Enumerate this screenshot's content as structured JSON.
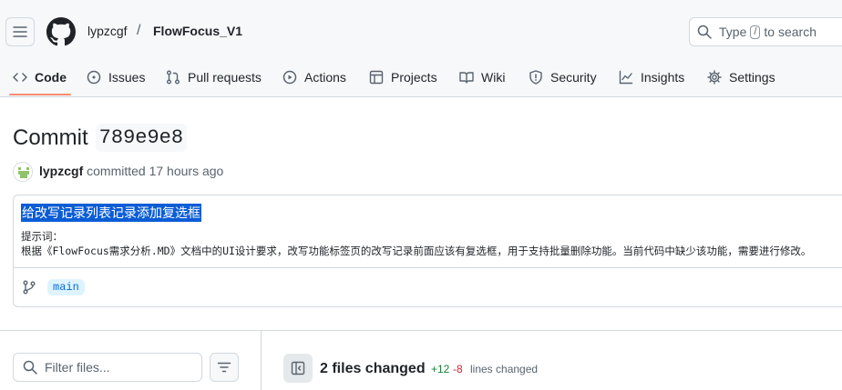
{
  "header": {
    "owner": "lypzcgf",
    "separator": "/",
    "repo": "FlowFocus_V1",
    "search": {
      "prefix": "Type",
      "key": "/",
      "suffix": "to search"
    }
  },
  "tabs": [
    {
      "label": "Code",
      "icon": "code-icon",
      "active": true
    },
    {
      "label": "Issues",
      "icon": "issue-icon"
    },
    {
      "label": "Pull requests",
      "icon": "pull-request-icon"
    },
    {
      "label": "Actions",
      "icon": "play-icon"
    },
    {
      "label": "Projects",
      "icon": "table-icon"
    },
    {
      "label": "Wiki",
      "icon": "book-icon"
    },
    {
      "label": "Security",
      "icon": "shield-icon"
    },
    {
      "label": "Insights",
      "icon": "graph-icon"
    },
    {
      "label": "Settings",
      "icon": "gear-icon"
    }
  ],
  "commit": {
    "heading": "Commit",
    "sha": "789e9e8",
    "author": "lypzcgf",
    "committed_text": "committed 17 hours ago",
    "title": "给改写记录列表记录添加复选框",
    "body_line1": "提示词：",
    "body_line2": "根据《FlowFocus需求分析.MD》文档中的UI设计要求，改写功能标签页的改写记录前面应该有复选框，用于支持批量删除功能。当前代码中缺少该功能，需要进行修改。",
    "branch": "main"
  },
  "files": {
    "filter_placeholder": "Filter files...",
    "files_changed": "2 files changed",
    "additions": "+12",
    "deletions": "-8",
    "lines_changed": "lines changed"
  },
  "colors": {
    "accent_underline": "#fd8c73",
    "link_blue": "#0969da",
    "selection": "#0b5dd6",
    "addition_green": "#1a7f37",
    "deletion_red": "#d1242f"
  }
}
